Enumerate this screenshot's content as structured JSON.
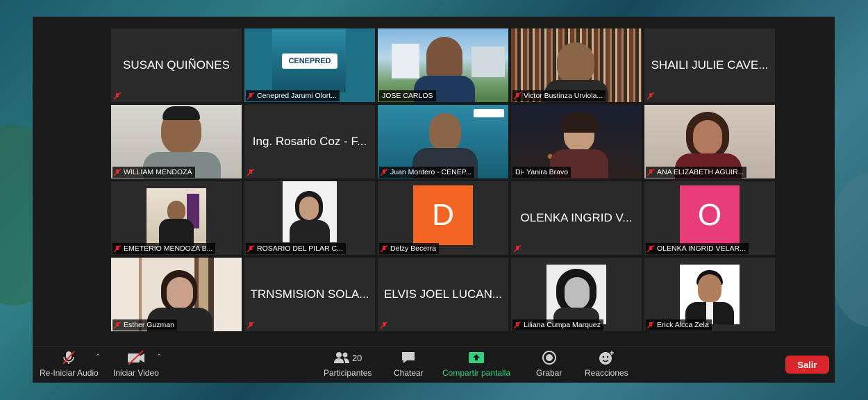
{
  "colors": {
    "active_border": "#d8e27a",
    "leave": "#d9262a",
    "share": "#35d07f",
    "avatar_d": "#f26522",
    "avatar_o": "#e93d7a"
  },
  "participants": [
    {
      "id": "p1",
      "name": "SUSAN QUIÑONES",
      "type": "name"
    },
    {
      "id": "p2",
      "name": "Cenepred Jarumi Olort...",
      "type": "logo",
      "logo_text": "CENEPRED"
    },
    {
      "id": "p3",
      "name": "JOSE CARLOS",
      "type": "video"
    },
    {
      "id": "p4",
      "name": "Victor Bustinza Urviola...",
      "type": "video"
    },
    {
      "id": "p5",
      "name": "SHAILI JULIE CAVE...",
      "type": "name"
    },
    {
      "id": "p6",
      "name": "WILLIAM MENDOZA",
      "type": "video"
    },
    {
      "id": "p7",
      "name": "Ing. Rosario Coz - F...",
      "type": "name"
    },
    {
      "id": "p8",
      "name": "Juan Montero - CENEP...",
      "type": "video"
    },
    {
      "id": "p9",
      "name": "Di- Yanira Bravo",
      "type": "video"
    },
    {
      "id": "p10",
      "name": "ANA ELIZABETH AGUIR...",
      "type": "video"
    },
    {
      "id": "p11",
      "name": "EMETERIO MENDOZA B...",
      "type": "thumb"
    },
    {
      "id": "p12",
      "name": "ROSARIO DEL PILAR C...",
      "type": "thumb"
    },
    {
      "id": "p13",
      "name": "Delzy Becerra",
      "type": "avatar",
      "initial": "D"
    },
    {
      "id": "p14",
      "name": "OLENKA INGRID V...",
      "type": "name"
    },
    {
      "id": "p15",
      "name": "OLENKA INGRID VELAR...",
      "type": "avatar",
      "initial": "O"
    },
    {
      "id": "p16",
      "name": "Esther Guzman",
      "type": "video"
    },
    {
      "id": "p17",
      "name": "TRNSMISION SOLA...",
      "type": "name"
    },
    {
      "id": "p18",
      "name": "ELVIS JOEL LUCAN...",
      "type": "name"
    },
    {
      "id": "p19",
      "name": "Liliana Cumpa Marquez",
      "type": "thumb"
    },
    {
      "id": "p20",
      "name": "Erick Alcca Zela",
      "type": "thumb"
    }
  ],
  "toolbar": {
    "audio_label": "Re-Iniciar Audio",
    "video_label": "Iniciar Video",
    "participants_label": "Participantes",
    "participants_count": "20",
    "chat_label": "Chatear",
    "share_label": "Compartir pantalla",
    "record_label": "Grabar",
    "reactions_label": "Reacciones",
    "leave_label": "Salir"
  }
}
